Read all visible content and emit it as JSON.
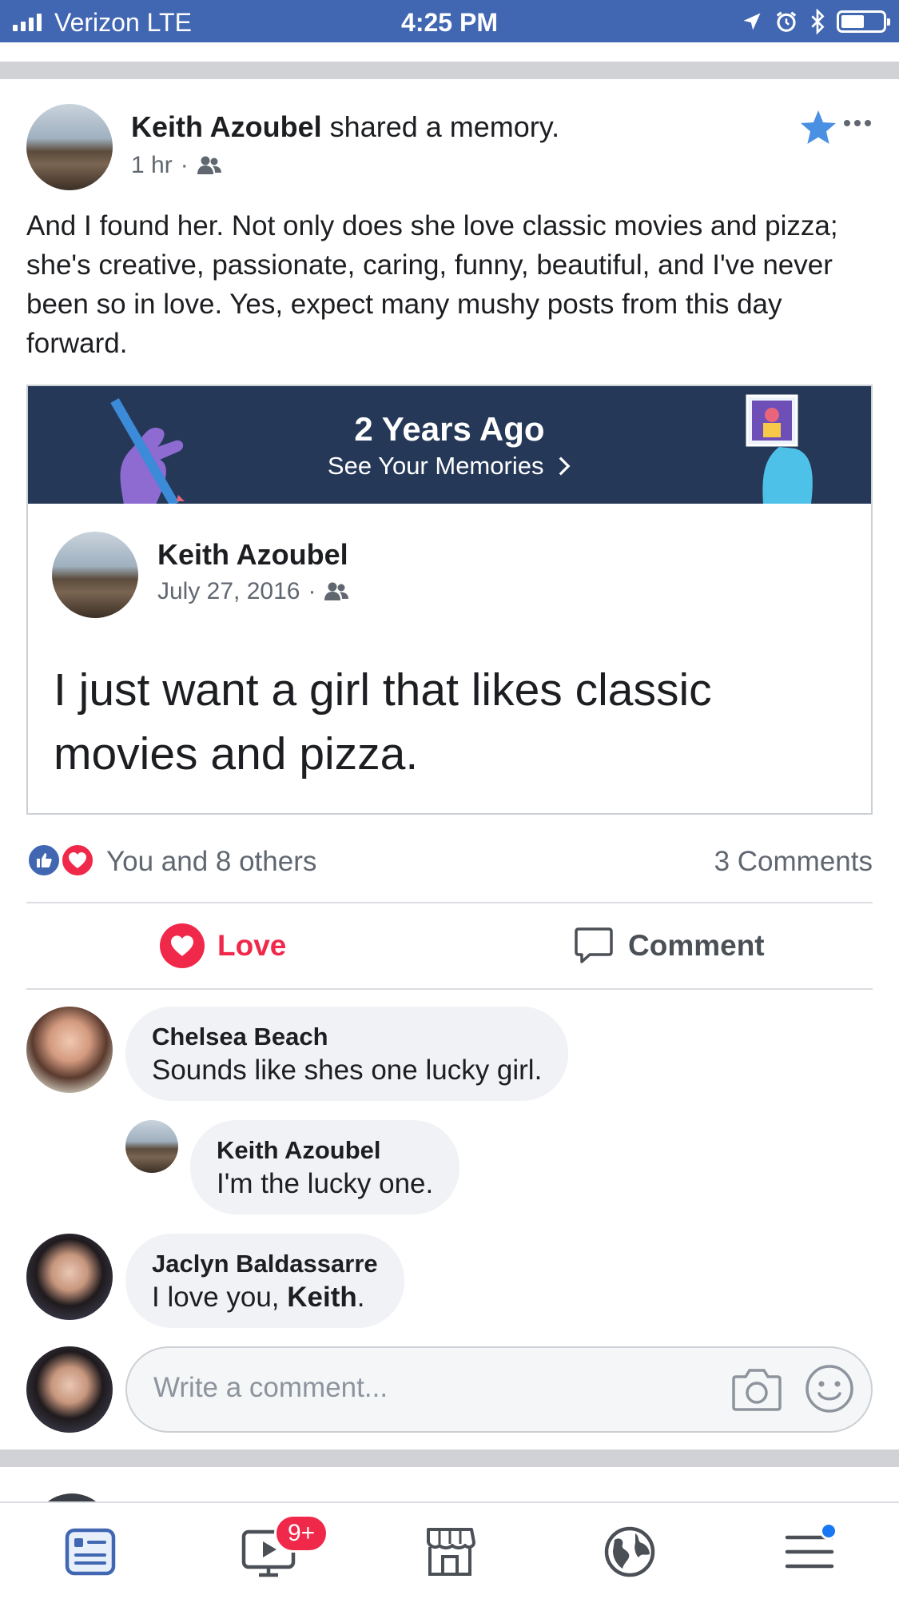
{
  "status_bar": {
    "carrier": "Verizon  LTE",
    "time": "4:25 PM"
  },
  "post": {
    "author": "Keith Azoubel",
    "action": " shared a memory.",
    "time": "1 hr",
    "text": "And I found her. Not only does she love classic movies and pizza; she's creative, passionate, caring, funny, beautiful, and I've never been so in love. Yes, expect many mushy posts from this day forward."
  },
  "memory": {
    "title": "2 Years Ago",
    "link": "See Your Memories",
    "author": "Keith Azoubel",
    "date": "July 27, 2016",
    "text": "I just want a girl that likes classic movies and pizza."
  },
  "reactions": {
    "summary": "You and 8 others",
    "comments": "3 Comments"
  },
  "actions": {
    "love": "Love",
    "comment": "Comment"
  },
  "comments": [
    {
      "name": "Chelsea Beach",
      "text": "Sounds like shes one lucky girl."
    },
    {
      "name": "Keith Azoubel",
      "text": "I'm the lucky one."
    },
    {
      "name": "Jaclyn Baldassarre",
      "text_prefix": "I love you, ",
      "text_bold": "Keith",
      "text_suffix": "."
    }
  ],
  "composer": {
    "placeholder": "Write a comment..."
  },
  "tab_bar": {
    "video_badge": "9+",
    "tabs": [
      "news-feed",
      "watch",
      "marketplace",
      "notifications-globe",
      "menu"
    ]
  },
  "colors": {
    "brand": "#4267b2",
    "love": "#f02849",
    "banner": "#253858",
    "star": "#4a90e2"
  }
}
